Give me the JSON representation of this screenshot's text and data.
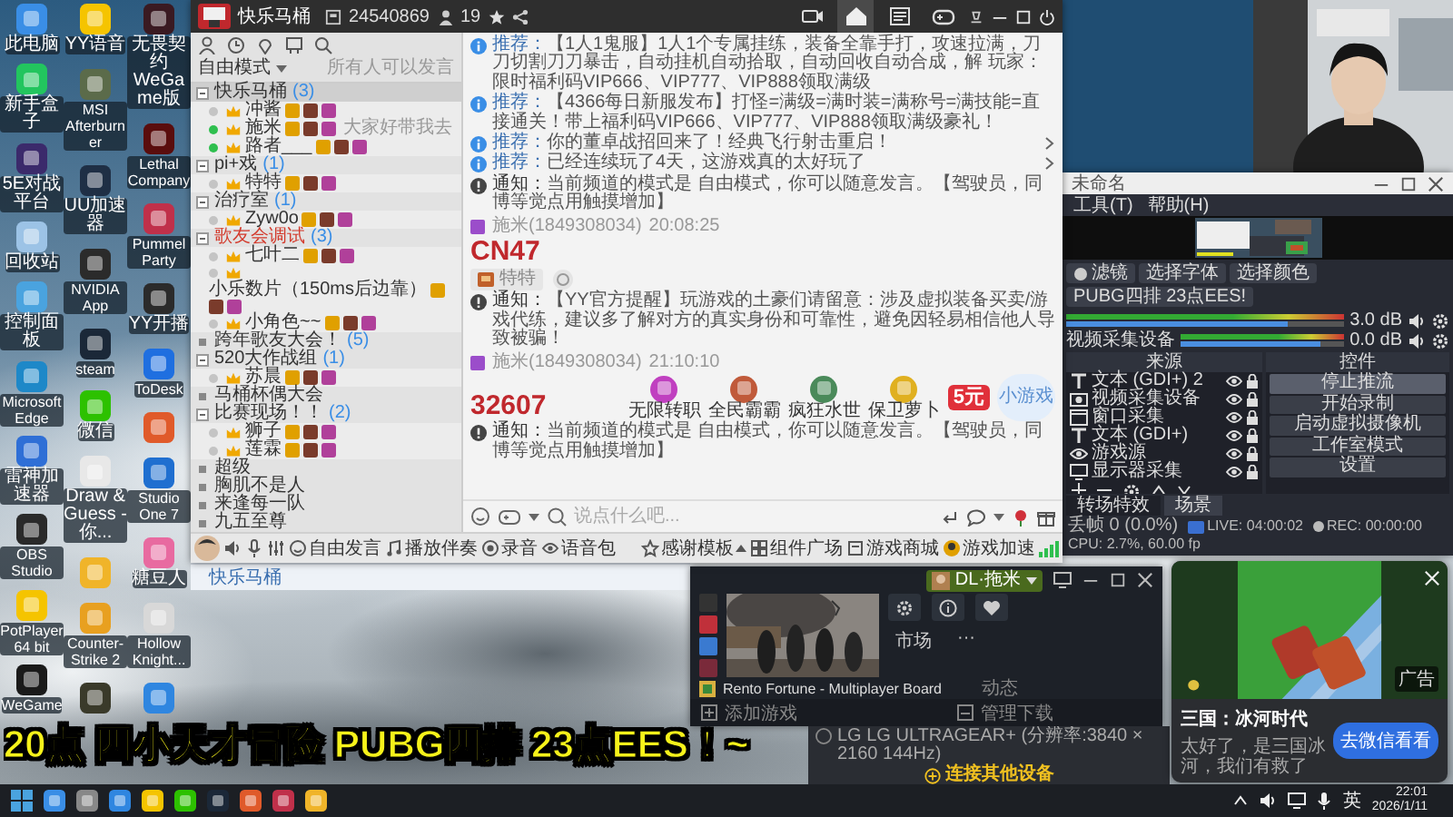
{
  "desktop": {
    "icon_columns": [
      [
        {
          "label": "此电脑",
          "color": "#3a8ee6"
        },
        {
          "label": "新手盒子",
          "color": "#22c55e"
        },
        {
          "label": "5E对战平台",
          "color": "#3b2a6b"
        },
        {
          "label": "回收站",
          "color": "#9cc3e6"
        },
        {
          "label": "控制面板",
          "color": "#4aa3df"
        },
        {
          "label": "Microsoft Edge",
          "color": "#1e88c8"
        },
        {
          "label": "雷神加速器",
          "color": "#2f6fd6"
        },
        {
          "label": "OBS Studio",
          "color": "#2a2a2a"
        },
        {
          "label": "PotPlayer 64 bit",
          "color": "#f5c400"
        },
        {
          "label": "WeGame",
          "color": "#1a1a1a"
        }
      ],
      [
        {
          "label": "YY语音",
          "color": "#f5c400"
        },
        {
          "label": "MSI Afterburner",
          "color": "#5b6b4a"
        },
        {
          "label": "UU加速器",
          "color": "#1f2f45"
        },
        {
          "label": "NVIDIA App",
          "color": "#2b2b2b"
        },
        {
          "label": "steam",
          "color": "#1b2838"
        },
        {
          "label": "微信",
          "color": "#2dc100"
        },
        {
          "label": "Draw & Guess - 你...",
          "color": "#e8e8e8"
        },
        {
          "color": "#f0b429"
        },
        {
          "label": "Counter-Strike 2",
          "color": "#e8a020"
        },
        {
          "color": "#3a3a2a"
        }
      ],
      [
        {
          "label": "无畏契约WeGame版",
          "color": "#3a1a22"
        },
        {
          "label": "Lethal Company",
          "color": "#5a0d0d"
        },
        {
          "label": "Pummel Party",
          "color": "#c0304a"
        },
        {
          "label": "YY开播",
          "color": "#2b2b2b"
        },
        {
          "label": "ToDesk",
          "color": "#1f6fe0"
        },
        {
          "color": "#e05a2a"
        },
        {
          "label": "Studio One 7",
          "color": "#1f6fd0"
        },
        {
          "label": "糖豆人",
          "color": "#e86aa0"
        },
        {
          "label": "Hollow Knight...",
          "color": "#d8d8d8"
        },
        {
          "color": "#2f86e0"
        }
      ]
    ]
  },
  "yy_window": {
    "channel_name": "快乐马桶",
    "channel_id": "24540869",
    "online_count": "19",
    "nav": [
      {
        "kind": "video",
        "selected": false
      },
      {
        "kind": "home",
        "selected": true
      },
      {
        "kind": "list",
        "selected": false
      },
      {
        "kind": "game",
        "selected": false
      }
    ],
    "sidebar": {
      "mode": "自由模式",
      "mode_hint": "所有人可以发言",
      "tree": [
        {
          "kind": "channel",
          "label": "快乐马桶",
          "count": "(3)",
          "selected": true,
          "expanded": true,
          "children": [
            {
              "kind": "user",
              "label": "冲酱",
              "online": false
            },
            {
              "kind": "user",
              "label": "施米",
              "online": true,
              "status": "大家好带我去"
            },
            {
              "kind": "user",
              "label": "路者___",
              "online": true
            }
          ]
        },
        {
          "kind": "channel",
          "label": "pi+戏",
          "count": "(1)",
          "selected": false,
          "expanded": true,
          "children": [
            {
              "kind": "user",
              "label": "特特",
              "online": false
            }
          ]
        },
        {
          "kind": "channel",
          "label": "治疗室",
          "count": "(1)",
          "selected": false,
          "expanded": true,
          "children": [
            {
              "kind": "user",
              "label": "Zyw0o",
              "online": false
            }
          ]
        },
        {
          "kind": "channel",
          "label": "歌友会调试",
          "count": "(3)",
          "color": "#d33a2c",
          "selected": false,
          "expanded": true,
          "children": [
            {
              "kind": "user",
              "label": "七叶二",
              "online": false
            },
            {
              "kind": "user",
              "label": "小乐数片（150ms后边靠）",
              "online": false
            },
            {
              "kind": "user",
              "label": "小角色~~",
              "online": false
            }
          ]
        },
        {
          "kind": "channel",
          "label": "跨年歌友大会！",
          "count": "(5)",
          "selected": false,
          "expanded": false
        },
        {
          "kind": "channel",
          "label": "520大作战组",
          "count": "(1)",
          "selected": false,
          "expanded": true,
          "children": [
            {
              "kind": "user",
              "label": "苏晨",
              "online": false
            }
          ]
        },
        {
          "kind": "channel",
          "label": "马桶杯偶大会",
          "selected": false,
          "expanded": false
        },
        {
          "kind": "channel",
          "label": "比赛现场！！",
          "count": "(2)",
          "selected": false,
          "expanded": true,
          "children": [
            {
              "kind": "user",
              "label": "狮子",
              "online": false
            },
            {
              "kind": "user",
              "label": "莲霖",
              "online": false
            }
          ]
        },
        {
          "kind": "channel",
          "label": "超级",
          "selected": false,
          "expanded": false
        },
        {
          "kind": "channel",
          "label": "胸肌不是人",
          "selected": false,
          "expanded": false
        },
        {
          "kind": "channel",
          "label": "来逢每一队",
          "selected": false,
          "expanded": false
        },
        {
          "kind": "channel",
          "label": "九五至尊",
          "selected": false,
          "expanded": false
        }
      ]
    },
    "messages": [
      {
        "kind": "promo",
        "tag": "推荐：",
        "text": "【1人1鬼服】1人1个专属挂练，装备全靠手打，攻速拉满，刀刀切割刀刀暴击，自动挂机自动拾取，自动回收自动合成，解 玩家：限时福利码VIP666、VIP777、VIP888领取满级"
      },
      {
        "kind": "promo",
        "tag": "推荐：",
        "text": "【4366每日新服发布】打怪=满级=满时装=满称号=满技能=直接通关！带上福利码VIP666、VIP777、VIP888领取满级豪礼！"
      },
      {
        "kind": "promo",
        "tag": "推荐：",
        "text": "你的董卓战招回来了！经典飞行射击重启！",
        "more": true
      },
      {
        "kind": "promo",
        "tag": "推荐：",
        "text": "已经连续玩了4天，这游戏真的太好玩了",
        "more": true
      },
      {
        "kind": "notice",
        "tag": "通知：",
        "text": "当前频道的模式是 自由模式，你可以随意发言。【驾驶员，同博等觉点用触摸增加】"
      },
      {
        "kind": "chat",
        "sender": "施米(1849308034)",
        "time": "20:08:25",
        "text": "CN47",
        "reply": "特特"
      },
      {
        "kind": "notice",
        "tag": "通知：",
        "text": "【YY官方提醒】玩游戏的土豪们请留意：涉及虚拟装备买卖/游戏代练，建议多了解对方的真实身份和可靠性，避免因轻易相信他人导致被骗！"
      },
      {
        "kind": "chat",
        "sender": "施米(1849308034)",
        "time": "21:10:10",
        "text": "32607"
      },
      {
        "kind": "notice",
        "tag": "通知：",
        "text": "当前频道的模式是 自由模式，你可以随意发言。【驾驶员，同博等觉点用触摸增加】"
      }
    ],
    "games": {
      "items": [
        {
          "label": "无限转职",
          "color": "#c040c0"
        },
        {
          "label": "全民霸霸",
          "color": "#c05a3a"
        },
        {
          "label": "疯狂水世",
          "color": "#4a8a5a"
        },
        {
          "label": "保卫萝卜",
          "color": "#e0b020"
        }
      ],
      "coupon": "5元",
      "more": "小游戏"
    },
    "input": {
      "placeholder": "说点什么吧..."
    },
    "toolbar": [
      {
        "kind": "mode",
        "label": "自由发言"
      },
      {
        "kind": "music",
        "label": "播放伴奏"
      },
      {
        "kind": "record",
        "label": "录音"
      },
      {
        "kind": "voice",
        "label": "语音包"
      },
      {
        "kind": "template",
        "label": "感谢模板"
      },
      {
        "kind": "widget",
        "label": "组件广场"
      },
      {
        "kind": "shop",
        "label": "游戏商城"
      },
      {
        "kind": "boost",
        "label": "游戏加速"
      }
    ]
  },
  "yy_mini_window": {
    "tab": "快乐马桶"
  },
  "obs_window": {
    "title": "未命名",
    "menu": [
      "工具(T)",
      "帮助(H)"
    ],
    "buttons": [
      {
        "kind": "filter",
        "label": "滤镜"
      },
      {
        "kind": "plain",
        "label": "选择字体"
      },
      {
        "kind": "plain",
        "label": "选择颜色"
      },
      {
        "kind": "plain",
        "label": "PUBG四排 23点EES!"
      }
    ],
    "mixer": [
      {
        "reading": "3.0 dB",
        "level": 0.8
      },
      {
        "name": "视频采集设备",
        "reading": "0.0 dB",
        "level": 0.85
      }
    ],
    "sources_title": "来源",
    "sources": [
      {
        "kind": "text",
        "label": "文本 (GDI+) 2"
      },
      {
        "kind": "camera",
        "label": "视频采集设备"
      },
      {
        "kind": "window",
        "label": "窗口采集"
      },
      {
        "kind": "text",
        "label": "文本 (GDI+)"
      },
      {
        "kind": "game",
        "label": "游戏源"
      },
      {
        "kind": "monitor",
        "label": "显示器采集"
      }
    ],
    "controls_title": "控件",
    "controls": [
      {
        "label": "停止推流",
        "active": true
      },
      {
        "label": "开始录制",
        "active": false
      },
      {
        "label": "启动虚拟摄像机",
        "active": false
      },
      {
        "label": "工作室模式",
        "active": false
      },
      {
        "label": "设置",
        "active": false
      }
    ],
    "scene_tabs": [
      {
        "label": "转场特效",
        "selected": false
      },
      {
        "label": "场景",
        "selected": true
      }
    ],
    "status": {
      "dropped": "丢帧 0 (0.0%)",
      "live": "LIVE: 04:00:02",
      "rec": "REC: 00:00:00",
      "cpu": "CPU: 2.7%, 60.00 fp"
    }
  },
  "launcher": {
    "user": "DL·拖米",
    "tabs": [
      "市场",
      "···"
    ],
    "game": "Rento Fortune - Multiplayer Board",
    "activity": "动态",
    "add_game": "添加游戏",
    "downloads": "管理下载"
  },
  "display_window": {
    "monitor": "LG LG ULTRAGEAR+ (分辨率:3840 × 2160 144Hz)",
    "connect": "连接其他设备"
  },
  "toast": {
    "ad_label": "广告",
    "title": "三国：冰河时代",
    "text": "太好了，是三国冰河，我们有救了",
    "button": "去微信看看"
  },
  "overlay": {
    "text": "20点 四小天才冒险 PUBG四排 23点EES！~"
  },
  "taskbar": {
    "apps": [
      {
        "color": "#3a8ee6"
      },
      {
        "color": "#888888"
      },
      {
        "color": "#2f86e0"
      },
      {
        "color": "#f5c400"
      },
      {
        "color": "#2dc100"
      },
      {
        "color": "#1b2838"
      },
      {
        "color": "#e05a2a"
      },
      {
        "color": "#c0304a"
      },
      {
        "color": "#f0b429"
      }
    ],
    "ime": "英",
    "time": "22:01",
    "date": "2026/1/11"
  }
}
